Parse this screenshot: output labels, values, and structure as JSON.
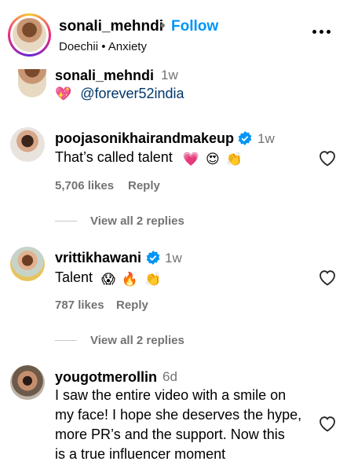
{
  "header": {
    "username": "sonali_mehndi",
    "separator": "•",
    "follow_label": "Follow",
    "subtitle": "Doechii • Anxiety"
  },
  "caption": {
    "username": "sonali_mehndi",
    "time": "1w",
    "emoji": "💖",
    "mention": "@forever52india"
  },
  "comments": [
    {
      "username": "poojasonikhairandmakeup",
      "verified": true,
      "time": "1w",
      "text": "That’s called talent",
      "emojis": [
        "💗",
        "😍",
        "👏"
      ],
      "likes": "5,706 likes",
      "reply_label": "Reply",
      "view_replies": "View all 2 replies"
    },
    {
      "username": "vrittikhawani",
      "verified": true,
      "time": "1w",
      "text": "Talent",
      "emojis": [
        "😱",
        "🔥",
        "👏"
      ],
      "likes": "787 likes",
      "reply_label": "Reply",
      "view_replies": "View all 2 replies"
    },
    {
      "username": "yougotmerollin",
      "verified": false,
      "time": "6d",
      "text_lines": [
        "I saw the entire video with a smile on",
        "my face! I hope she deserves the hype,",
        "more PR’s and the support. Now this",
        "is a true influencer moment"
      ]
    }
  ],
  "colors": {
    "accent": "#0095f6",
    "muted": "#737373",
    "verified": "#0095f6"
  }
}
